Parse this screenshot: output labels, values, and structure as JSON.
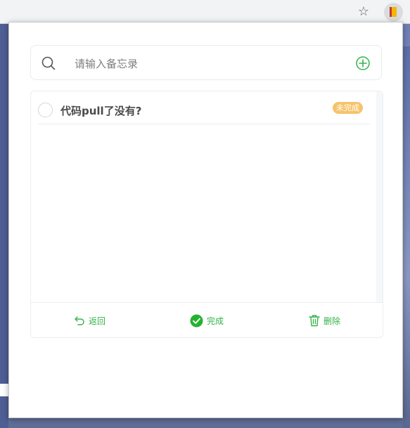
{
  "browser": {
    "star_icon": "☆"
  },
  "search": {
    "placeholder": "请输入备忘录",
    "value": ""
  },
  "todos": [
    {
      "text": "代码pull了没有?",
      "status": "未完成",
      "done": false
    }
  ],
  "footer": {
    "back_label": "返回",
    "done_label": "完成",
    "delete_label": "删除"
  },
  "colors": {
    "accent": "#33b34a",
    "badge": "#f6c36b",
    "text": "#4a4a4a"
  }
}
